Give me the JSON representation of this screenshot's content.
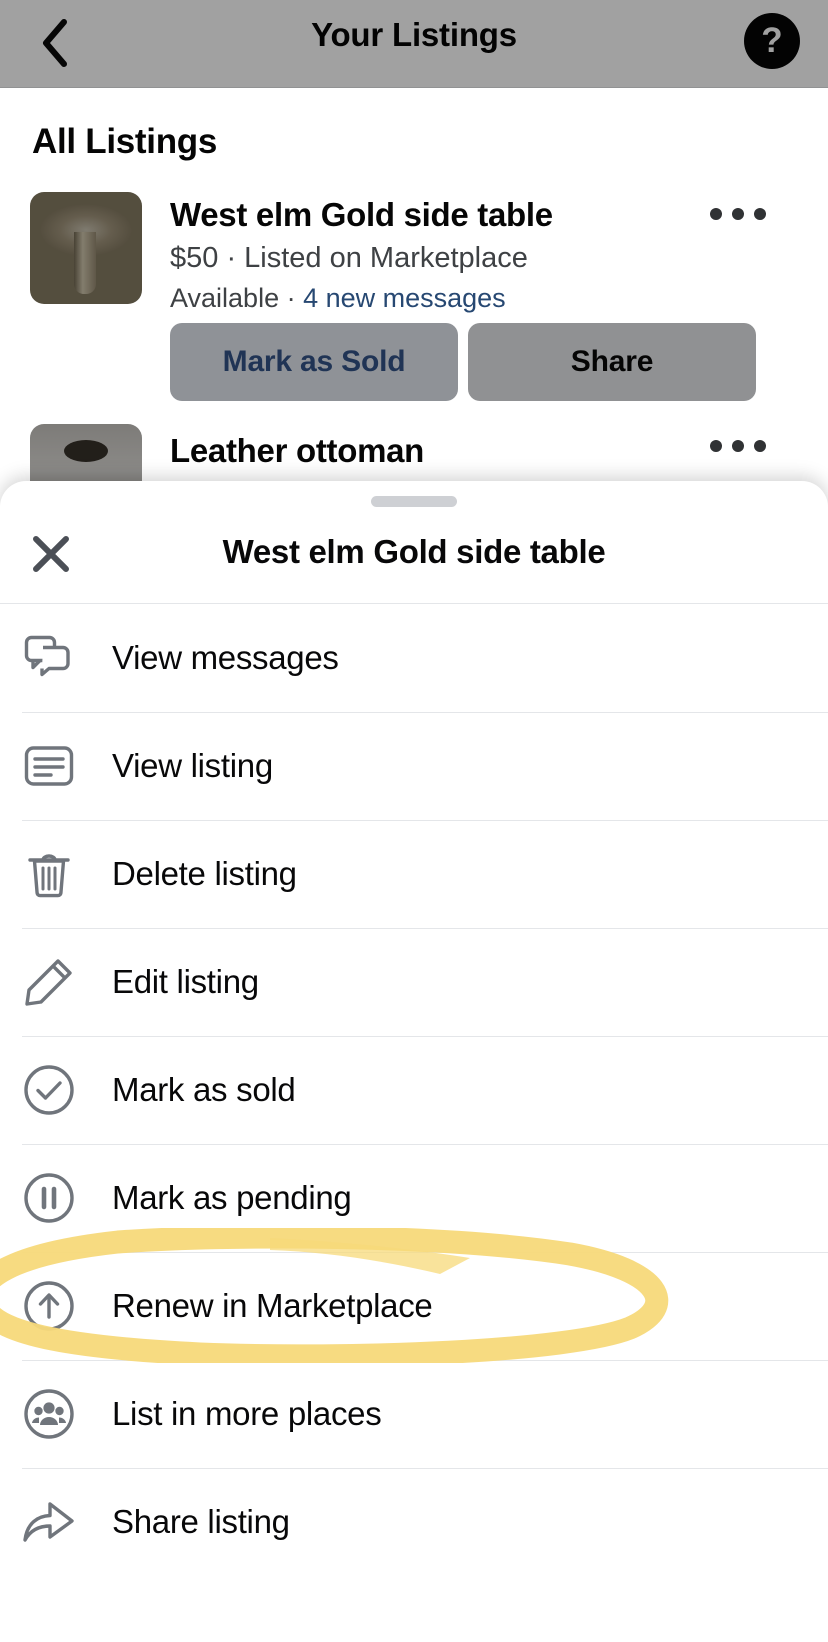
{
  "nav": {
    "back_icon": "chevron-left-icon",
    "title": "Your Listings",
    "help_icon": "question-mark-icon",
    "help_glyph": "?"
  },
  "background_page": {
    "section_title": "All Listings",
    "listings": [
      {
        "title": "West elm Gold side table",
        "subtitle": "$50 · Listed on Marketplace",
        "status": "Available · ",
        "messages_link": "4 new messages",
        "thumb": "gold-side-table-photo",
        "actions": [
          {
            "label": "Mark as Sold",
            "style": "primary"
          },
          {
            "label": "Share",
            "style": "secondary"
          }
        ]
      },
      {
        "title": "Leather ottoman",
        "thumb": "leather-ottoman-photo"
      }
    ],
    "overflow_icon": "more-options-icon"
  },
  "sheet": {
    "handle": "drag-handle",
    "close_icon": "close-icon",
    "title": "West elm Gold side table",
    "items": [
      {
        "label": "View messages",
        "icon": "messages-icon"
      },
      {
        "label": "View listing",
        "icon": "listing-card-icon"
      },
      {
        "label": "Delete listing",
        "icon": "trash-icon"
      },
      {
        "label": "Edit listing",
        "icon": "pencil-icon"
      },
      {
        "label": "Mark as sold",
        "icon": "check-circle-icon"
      },
      {
        "label": "Mark as pending",
        "icon": "pause-circle-icon"
      },
      {
        "label": "Renew in Marketplace",
        "icon": "arrow-up-circle-icon"
      },
      {
        "label": "List in more places",
        "icon": "people-circle-icon"
      },
      {
        "label": "Share listing",
        "icon": "share-arrow-icon"
      }
    ]
  },
  "annotation": {
    "type": "highlighter-circle",
    "target": "Renew in Marketplace",
    "color": "#f7d97a"
  },
  "colors": {
    "accent_blue": "#1877f2",
    "primary_button_bg": "#dfe8f7",
    "secondary_button_bg": "#e4e6eb",
    "text_primary": "#080809",
    "text_secondary": "#606770",
    "divider": "#e4e6e9",
    "highlighter": "#f7d97a"
  }
}
